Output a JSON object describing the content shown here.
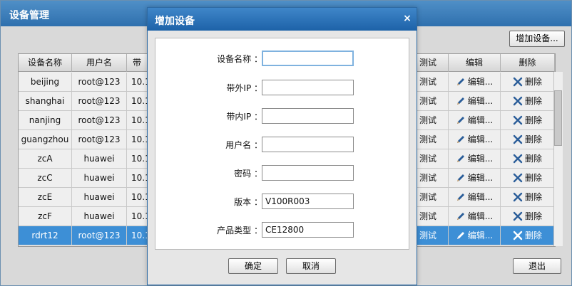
{
  "main_window": {
    "title": "设备管理",
    "add_button": "增加设备...",
    "exit_button": "退出"
  },
  "table": {
    "columns": [
      "设备名称",
      "用户名",
      "带",
      "测试",
      "编辑",
      "删除"
    ],
    "rows": [
      {
        "name": "beijing",
        "user": "root@123",
        "ip": "10.1",
        "test": "测试",
        "edit": "编辑...",
        "del": "删除"
      },
      {
        "name": "shanghai",
        "user": "root@123",
        "ip": "10.1",
        "test": "测试",
        "edit": "编辑...",
        "del": "删除"
      },
      {
        "name": "nanjing",
        "user": "root@123",
        "ip": "10.1",
        "test": "测试",
        "edit": "编辑...",
        "del": "删除"
      },
      {
        "name": "guangzhou",
        "user": "root@123",
        "ip": "10.1",
        "test": "测试",
        "edit": "编辑...",
        "del": "删除"
      },
      {
        "name": "zcA",
        "user": "huawei",
        "ip": "10.1",
        "test": "测试",
        "edit": "编辑...",
        "del": "删除"
      },
      {
        "name": "zcC",
        "user": "huawei",
        "ip": "10.1",
        "test": "测试",
        "edit": "编辑...",
        "del": "删除"
      },
      {
        "name": "zcE",
        "user": "huawei",
        "ip": "10.1",
        "test": "测试",
        "edit": "编辑...",
        "del": "删除"
      },
      {
        "name": "zcF",
        "user": "huawei",
        "ip": "10.1",
        "test": "测试",
        "edit": "编辑...",
        "del": "删除"
      },
      {
        "name": "rdrt12",
        "user": "root@123",
        "ip": "10.1",
        "test": "测试",
        "edit": "编辑...",
        "del": "删除"
      }
    ],
    "selected_row": 8
  },
  "dialog": {
    "title": "增加设备",
    "close_icon": "×",
    "fields": [
      {
        "label": "设备名称 ：",
        "value": ""
      },
      {
        "label": "带外IP ：",
        "value": ""
      },
      {
        "label": "带内IP ：",
        "value": ""
      },
      {
        "label": "用户名 ：",
        "value": ""
      },
      {
        "label": "密码 ：",
        "value": ""
      },
      {
        "label": "版本 ：",
        "value": "V100R003"
      },
      {
        "label": "产品类型 ：",
        "value": "CE12800"
      }
    ],
    "ok_button": "确定",
    "cancel_button": "取消"
  },
  "colors": {
    "title_bar": "#2f70ae",
    "selected_row": "#3d8fd6",
    "edit_icon": "#2a5d99",
    "delete_icon": "#2a5d99"
  },
  "icons": {
    "edit": "pencil-icon",
    "delete": "x-mark-icon",
    "close": "close-icon"
  }
}
